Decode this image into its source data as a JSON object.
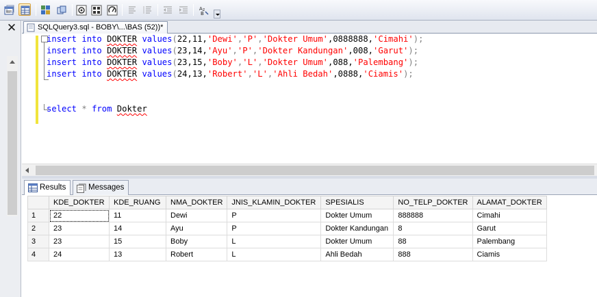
{
  "toolbar": {
    "buttons": [
      {
        "name": "results-to-text-icon"
      },
      {
        "name": "results-to-grid-icon"
      },
      {
        "name": "results-to-file-icon"
      },
      {
        "name": "include-plan-icon"
      },
      {
        "name": "query-options-icon"
      },
      {
        "name": "client-stats-icon"
      },
      {
        "name": "comment-icon"
      },
      {
        "name": "uncomment-icon"
      },
      {
        "name": "decrease-indent-icon"
      },
      {
        "name": "increase-indent-icon"
      },
      {
        "name": "specify-values-icon"
      }
    ]
  },
  "document_tab": {
    "title": "SQLQuery3.sql - BOBY\\...\\BAS (52))*"
  },
  "editor": {
    "lines": [
      {
        "kw1": "insert",
        "kw2": "into",
        "table": "DOKTER",
        "kw3": "values",
        "open": "(",
        "a": "22,11,",
        "s1": "'Dewi'",
        "c1": ",",
        "s2": "'P'",
        "c2": ",",
        "s3": "'Dokter Umum'",
        "b": ",0888888,",
        "s4": "'Cimahi'",
        "close": ");"
      },
      {
        "kw1": "insert",
        "kw2": "into",
        "table": "DOKTER",
        "kw3": "values",
        "open": "(",
        "a": "23,14,",
        "s1": "'Ayu'",
        "c1": ",",
        "s2": "'P'",
        "c2": ",",
        "s3": "'Dokter Kandungan'",
        "b": ",008,",
        "s4": "'Garut'",
        "close": ");"
      },
      {
        "kw1": "insert",
        "kw2": "into",
        "table": "DOKTER",
        "kw3": "values",
        "open": "(",
        "a": "23,15,",
        "s1": "'Boby'",
        "c1": ",",
        "s2": "'L'",
        "c2": ",",
        "s3": "'Dokter Umum'",
        "b": ",088,",
        "s4": "'Palembang'",
        "close": ");"
      },
      {
        "kw1": "insert",
        "kw2": "into",
        "table": "DOKTER",
        "kw3": "values",
        "open": "(",
        "a": "24,13,",
        "s1": "'Robert'",
        "c1": ",",
        "s2": "'L'",
        "c2": ",",
        "s3": "'Ahli Bedah'",
        "b": ",0888,",
        "s4": "'Ciamis'",
        "close": ");"
      }
    ],
    "select_line": {
      "kw1": "select",
      "star": "*",
      "kw2": "from",
      "table": "Dokter"
    }
  },
  "result_tabs": {
    "results": "Results",
    "messages": "Messages"
  },
  "grid": {
    "columns": [
      "KDE_DOKTER",
      "KDE_RUANG",
      "NMA_DOKTER",
      "JNIS_KLAMIN_DOKTER",
      "SPESIALIS",
      "NO_TELP_DOKTER",
      "ALAMAT_DOKTER"
    ],
    "rows": [
      {
        "n": "1",
        "cells": [
          "22",
          "11",
          "Dewi",
          "P",
          "Dokter Umum",
          "888888",
          "Cimahi"
        ]
      },
      {
        "n": "2",
        "cells": [
          "23",
          "14",
          "Ayu",
          "P",
          "Dokter Kandungan",
          "8",
          "Garut"
        ]
      },
      {
        "n": "3",
        "cells": [
          "23",
          "15",
          "Boby",
          "L",
          "Dokter Umum",
          "88",
          "Palembang"
        ]
      },
      {
        "n": "4",
        "cells": [
          "24",
          "13",
          "Robert",
          "L",
          "Ahli Bedah",
          "888",
          "Ciamis"
        ]
      }
    ]
  },
  "colors": {
    "keyword": "#0000ff",
    "string": "#ff0000",
    "operator": "#808080",
    "margin_change_bar": "#f1e43c"
  }
}
